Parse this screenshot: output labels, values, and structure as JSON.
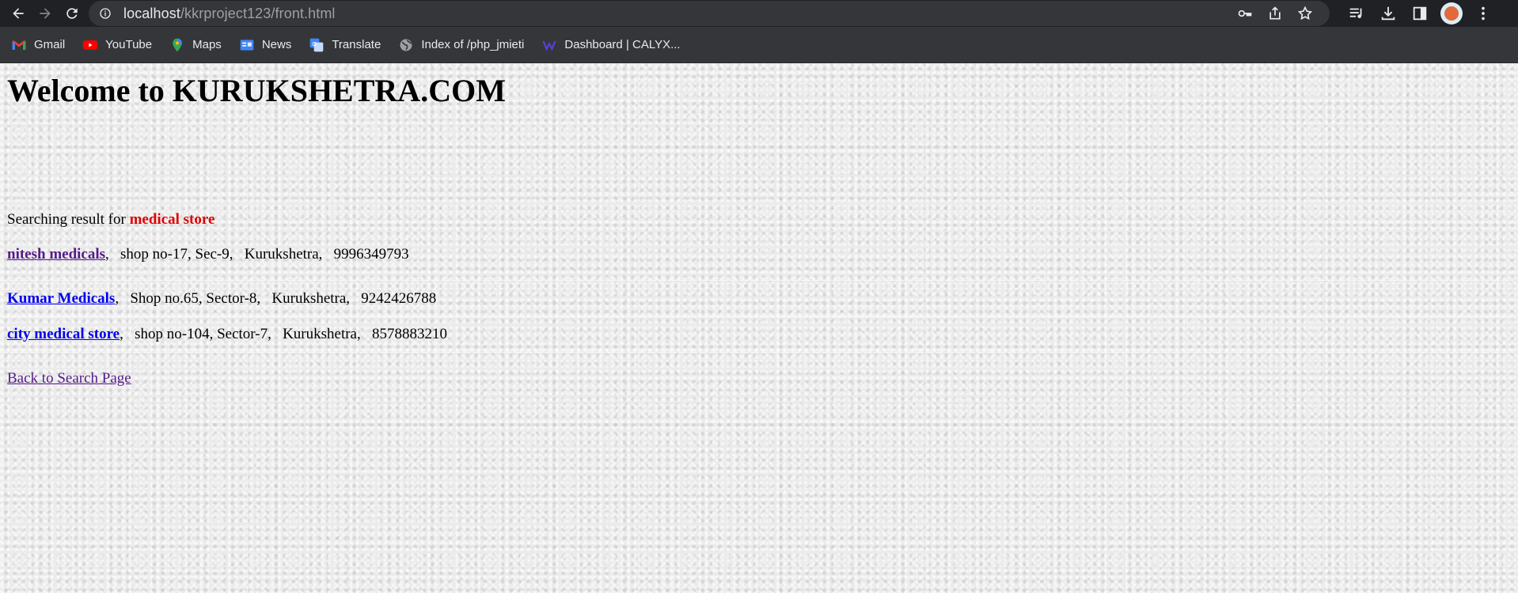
{
  "browser": {
    "url_host": "localhost",
    "url_path": "/kkrproject123/front.html",
    "bookmarks": [
      {
        "label": "Gmail",
        "icon": "gmail-icon"
      },
      {
        "label": "YouTube",
        "icon": "youtube-icon"
      },
      {
        "label": "Maps",
        "icon": "maps-icon"
      },
      {
        "label": "News",
        "icon": "news-icon"
      },
      {
        "label": "Translate",
        "icon": "translate-icon"
      },
      {
        "label": "Index of /php_jmieti",
        "icon": "globe-icon"
      },
      {
        "label": "Dashboard | CALYX...",
        "icon": "calyx-icon"
      }
    ]
  },
  "page": {
    "title": "Welcome to KURUKSHETRA.COM",
    "search_prefix": "Searching result for ",
    "search_term": "medical store",
    "results": [
      {
        "name": "nitesh medicals",
        "details": ",   shop no-17, Sec-9,   Kurukshetra,   9996349793",
        "visited": true
      },
      {
        "name": "Kumar Medicals",
        "details": ",   Shop no.65, Sector-8,   Kurukshetra,   9242426788",
        "visited": false
      },
      {
        "name": "city medical store",
        "details": ",   shop no-104, Sector-7,   Kurukshetra,   8578883210",
        "visited": false
      }
    ],
    "back_link": "Back to Search Page"
  }
}
